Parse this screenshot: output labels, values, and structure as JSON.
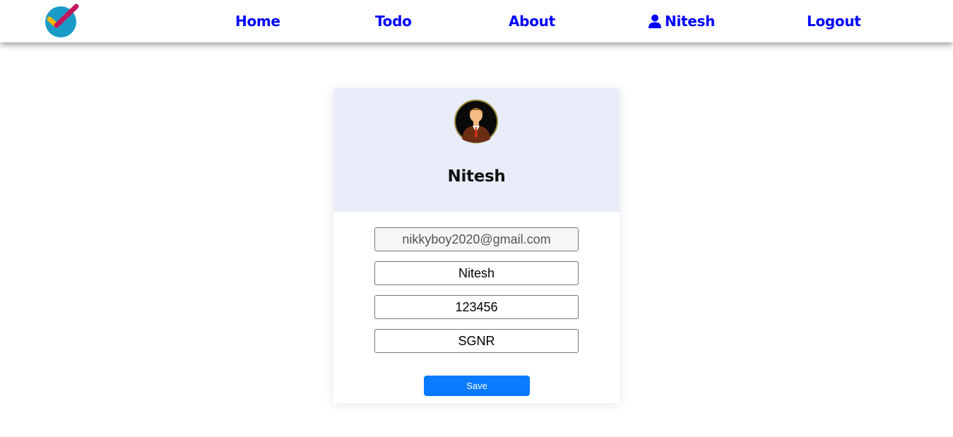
{
  "nav": {
    "logo_icon": "checkmark-logo-icon",
    "home": "Home",
    "todo": "Todo",
    "about": "About",
    "user_icon": "user-icon",
    "user": "Nitesh",
    "logout": "Logout"
  },
  "profile": {
    "avatar_icon": "avatar-icon",
    "name": "Nitesh",
    "fields": {
      "email": "nikkyboy2020@gmail.com",
      "name": "Nitesh",
      "phone": "123456",
      "city": "SGNR"
    },
    "save_label": "Save"
  },
  "colors": {
    "nav_link": "#0000ff",
    "header_bg": "#e9edf9",
    "save_button": "#0a7bff"
  }
}
